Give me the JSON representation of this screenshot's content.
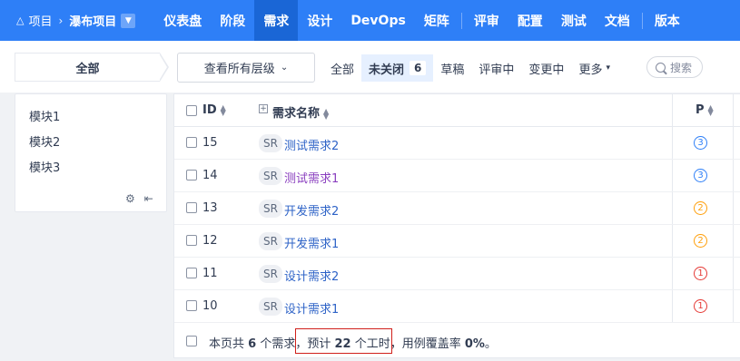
{
  "nav": {
    "project_icon": "project-icon",
    "crumb_project": "项目",
    "crumb_current": "瀑布项目",
    "items": [
      {
        "label": "仪表盘"
      },
      {
        "label": "阶段"
      },
      {
        "label": "需求",
        "active": true
      },
      {
        "label": "设计"
      },
      {
        "label": "DevOps"
      },
      {
        "label": "矩阵"
      },
      {
        "label": "评审"
      },
      {
        "label": "配置"
      },
      {
        "label": "测试"
      },
      {
        "label": "文档"
      },
      {
        "label": "版本"
      }
    ]
  },
  "filter": {
    "all_label": "全部",
    "level_label": "查看所有层级",
    "tabs": [
      {
        "label": "全部"
      },
      {
        "label": "未关闭",
        "count": "6",
        "active": true
      },
      {
        "label": "草稿"
      },
      {
        "label": "评审中"
      },
      {
        "label": "变更中"
      },
      {
        "label": "更多"
      }
    ],
    "search_placeholder": "搜索"
  },
  "modules": {
    "items": [
      "模块1",
      "模块2",
      "模块3"
    ]
  },
  "table": {
    "headers": {
      "id": "ID",
      "name": "需求名称",
      "pri": "P"
    },
    "rows": [
      {
        "id": "15",
        "type": "SR",
        "name": "测试需求2",
        "pri": "3",
        "visited": false
      },
      {
        "id": "14",
        "type": "SR",
        "name": "测试需求1",
        "pri": "3",
        "visited": true
      },
      {
        "id": "13",
        "type": "SR",
        "name": "开发需求2",
        "pri": "2",
        "visited": false
      },
      {
        "id": "12",
        "type": "SR",
        "name": "开发需求1",
        "pri": "2",
        "visited": false
      },
      {
        "id": "11",
        "type": "SR",
        "name": "设计需求2",
        "pri": "1",
        "visited": false
      },
      {
        "id": "10",
        "type": "SR",
        "name": "设计需求1",
        "pri": "1",
        "visited": false
      }
    ],
    "footer": {
      "part1": "本页共 ",
      "count": "6",
      "part2": " 个需求，",
      "part3": "预计 ",
      "hours": "22",
      "part4": " 个工时，",
      "part5": "用例覆盖率 ",
      "coverage": "0%",
      "part6": "。"
    }
  },
  "colors": {
    "brand": "#2e7ff7",
    "pri3": "#2e7ff7",
    "pri2": "#ff9f0a",
    "pri1": "#e53935",
    "highlight_box": "#d0201b"
  }
}
